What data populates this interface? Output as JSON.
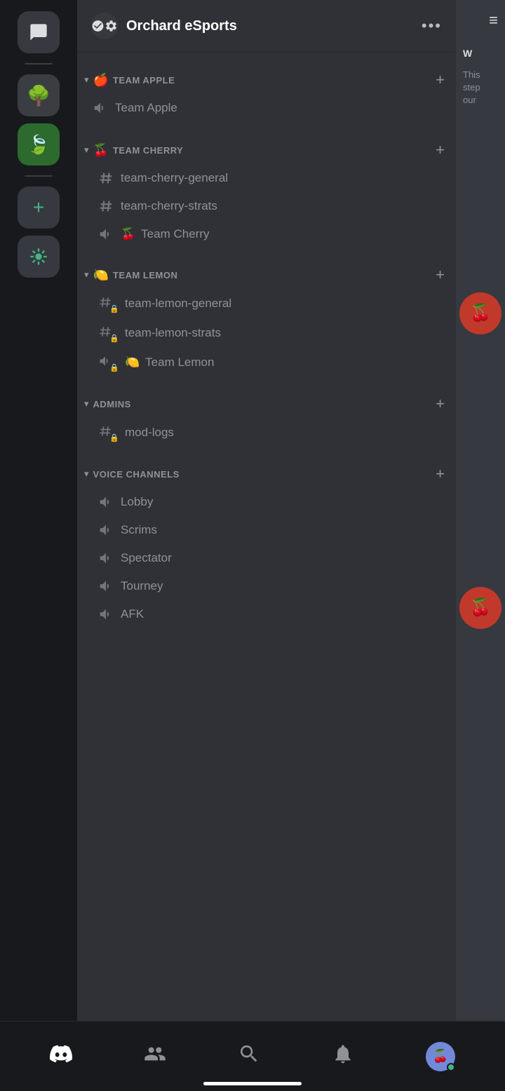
{
  "server": {
    "name": "Orchard eSports",
    "icon_emoji": "⚙️"
  },
  "right_panel": {
    "header_icon": "☰",
    "title": "W",
    "body_text": "This step our"
  },
  "categories": [
    {
      "id": "team-apple",
      "name": "TEAM APPLE",
      "emoji": "🍎",
      "collapsed": false,
      "channels": [
        {
          "id": "team-apple-partial",
          "name": "Team Apple",
          "type": "text-partial"
        }
      ]
    },
    {
      "id": "team-cherry",
      "name": "TEAM CHERRY",
      "emoji": "🍒",
      "collapsed": false,
      "channels": [
        {
          "id": "team-cherry-general",
          "name": "team-cherry-general",
          "type": "text"
        },
        {
          "id": "team-cherry-strats",
          "name": "team-cherry-strats",
          "type": "text"
        },
        {
          "id": "team-cherry-voice",
          "name": "Team Cherry",
          "emoji": "🍒",
          "type": "voice"
        }
      ]
    },
    {
      "id": "team-lemon",
      "name": "TEAM LEMON",
      "emoji": "🍋",
      "collapsed": false,
      "channels": [
        {
          "id": "team-lemon-general",
          "name": "team-lemon-general",
          "type": "text-locked"
        },
        {
          "id": "team-lemon-strats",
          "name": "team-lemon-strats",
          "type": "text-locked"
        },
        {
          "id": "team-lemon-voice",
          "name": "Team Lemon",
          "emoji": "🍋",
          "type": "voice-locked"
        }
      ]
    },
    {
      "id": "admins",
      "name": "ADMINS",
      "emoji": "",
      "collapsed": false,
      "channels": [
        {
          "id": "mod-logs",
          "name": "mod-logs",
          "type": "text-locked"
        }
      ]
    },
    {
      "id": "voice-channels",
      "name": "VOICE CHANNELS",
      "emoji": "",
      "collapsed": false,
      "channels": [
        {
          "id": "lobby",
          "name": "Lobby",
          "type": "voice"
        },
        {
          "id": "scrims",
          "name": "Scrims",
          "type": "voice"
        },
        {
          "id": "spectator",
          "name": "Spectator",
          "type": "voice"
        },
        {
          "id": "tourney",
          "name": "Tourney",
          "type": "voice"
        },
        {
          "id": "afk",
          "name": "AFK",
          "type": "voice"
        }
      ]
    }
  ],
  "bottom_nav": {
    "items": [
      {
        "id": "home",
        "icon": "discord",
        "label": ""
      },
      {
        "id": "friends",
        "icon": "friends",
        "label": ""
      },
      {
        "id": "search",
        "icon": "search",
        "label": ""
      },
      {
        "id": "notifications",
        "icon": "bell",
        "label": ""
      },
      {
        "id": "profile",
        "icon": "avatar",
        "label": ""
      }
    ]
  },
  "more_button_label": "•••",
  "add_channel_label": "+"
}
